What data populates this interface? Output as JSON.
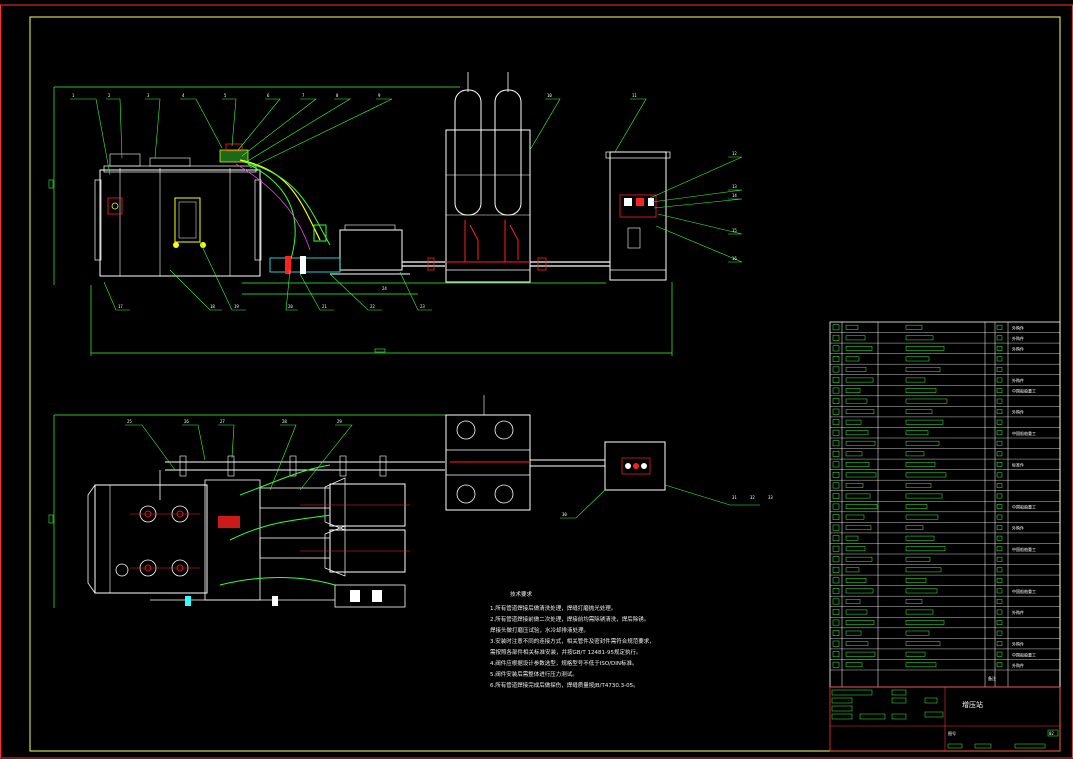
{
  "drawing": {
    "sheet_title": "增压站",
    "figure_no_label": "图号",
    "stamp": "02"
  },
  "callouts_front": [
    "1",
    "2",
    "3",
    "4",
    "5",
    "6",
    "7",
    "8",
    "9",
    "10",
    "11",
    "12",
    "13",
    "14",
    "15",
    "16",
    "17",
    "18",
    "19",
    "20",
    "21",
    "22",
    "23",
    "24"
  ],
  "callouts_top": [
    "25",
    "26",
    "27",
    "28",
    "29",
    "30",
    "31",
    "32",
    "33"
  ],
  "tech_notes": {
    "heading": "技术要求",
    "lines": [
      "1.所有管道焊接后做清洗处理，焊缝打磨抛光处理。",
      "2.所有管道焊接前做二次处理，焊接前均需除锈清洗，焊后除锈。",
      "   焊接头做打磨压试验，水冷却排液处理。",
      "3.安装时注意不同的连接方式，相关管件及密封件需符合规范要求，",
      "   需按照各部件相关标准安装，并按GB/T 12481-95规定执行。",
      "4.阀件应根据设计参数选型，规格型号不低于ISO/DIN标准。",
      "5.阀件安装后需整体进行压力测试。",
      "6.所有管道焊接完成后做探伤，焊缝质量按JB/T4730.3-05。"
    ]
  },
  "bom": {
    "remarks": [
      "外购件",
      "外购件",
      "外购件",
      "",
      "",
      "外购件",
      "中国船舶重工",
      "",
      "外购件",
      "",
      "中国船舶重工",
      "",
      "",
      "标准件",
      "",
      "",
      "",
      "中国船舶重工",
      "",
      "外购件",
      "",
      "中国船舶重工",
      "",
      "",
      "",
      "中国船舶重工",
      "",
      "外购件",
      "",
      "",
      "外购件",
      "中国船舶重工",
      "外购件"
    ],
    "footer_left": "备注"
  },
  "colors": {
    "background": "#000000",
    "frame": "#ffff66",
    "outer_frame": "#ff3333",
    "green": "#33ff33",
    "white": "#ffffff",
    "red": "#ff2020",
    "cyan": "#33ffff",
    "yellow": "#ffff00",
    "magenta": "#ff44ff"
  }
}
